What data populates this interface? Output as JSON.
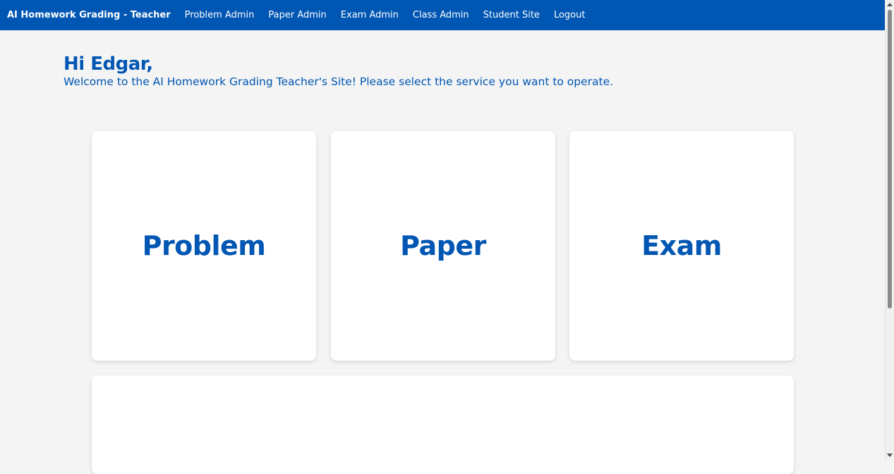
{
  "navbar": {
    "brand": "AI Homework Grading - Teacher",
    "links": [
      "Problem Admin",
      "Paper Admin",
      "Exam Admin",
      "Class Admin",
      "Student Site",
      "Logout"
    ]
  },
  "main": {
    "greeting": "Hi Edgar,",
    "welcome": "Welcome to the AI Homework Grading Teacher's Site! Please select the service you want to operate.",
    "cards": [
      "Problem",
      "Paper",
      "Exam"
    ]
  },
  "colors": {
    "brand": "#0056b3",
    "background": "#f4f4f4",
    "card": "#ffffff"
  }
}
